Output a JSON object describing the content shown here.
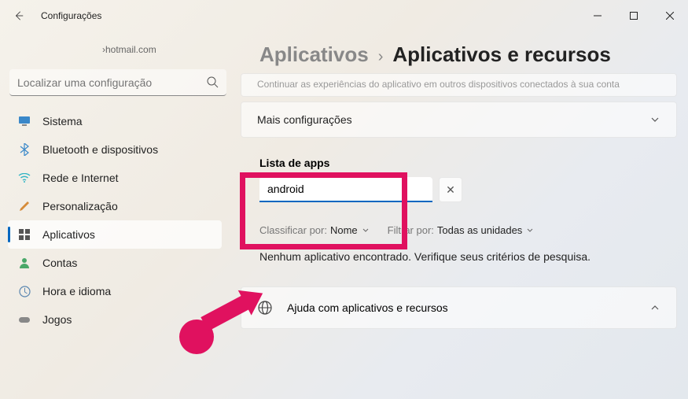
{
  "window": {
    "title": "Configurações"
  },
  "account": {
    "email": "›hotmail.com"
  },
  "sidebar_search": {
    "placeholder": "Localizar uma configuração"
  },
  "sidebar": {
    "items": [
      {
        "label": "Sistema"
      },
      {
        "label": "Bluetooth e dispositivos"
      },
      {
        "label": "Rede e Internet"
      },
      {
        "label": "Personalização"
      },
      {
        "label": "Aplicativos"
      },
      {
        "label": "Contas"
      },
      {
        "label": "Hora e idioma"
      },
      {
        "label": "Jogos"
      }
    ]
  },
  "breadcrumb": {
    "parent": "Aplicativos",
    "current": "Aplicativos e recursos"
  },
  "cards": {
    "cut_text": "Continuar as experiências do aplicativo em outros dispositivos conectados à sua conta",
    "more": "Mais configurações"
  },
  "apps": {
    "list_title": "Lista de apps",
    "search_value": "android",
    "sort_label": "Classificar por:",
    "sort_value": "Nome",
    "filter_label": "Filtrar por:",
    "filter_value": "Todas as unidades",
    "no_result": "Nenhum aplicativo encontrado. Verifique seus critérios de pesquisa."
  },
  "help": {
    "title": "Ajuda com aplicativos e recursos"
  }
}
